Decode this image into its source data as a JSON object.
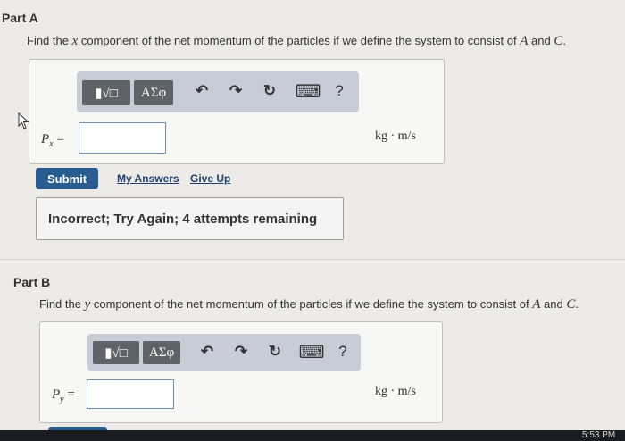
{
  "part_a": {
    "title": "Part A",
    "prompt_pre": "Find the ",
    "prompt_var": "x",
    "prompt_mid": " component of the net momentum of the particles if we define the system to consist of ",
    "prompt_a": "A",
    "prompt_and": " and ",
    "prompt_c": "C",
    "prompt_end": ".",
    "var_label": "P",
    "var_sub": "x",
    "var_eq": "=",
    "input_value": "",
    "units": "kg · m/s",
    "submit_label": "Submit",
    "my_answers_label": "My Answers",
    "give_up_label": "Give Up",
    "feedback": "Incorrect; Try Again; 4 attempts remaining"
  },
  "part_b": {
    "title": "Part B",
    "prompt_pre": "Find the ",
    "prompt_var": "y",
    "prompt_mid": " component of the net momentum of the particles if we define the system to consist of ",
    "prompt_a": "A",
    "prompt_and": " and ",
    "prompt_c": "C",
    "prompt_end": ".",
    "var_label": "P",
    "var_sub": "y",
    "var_eq": "=",
    "input_value": "",
    "units": "kg · m/s"
  },
  "toolbar": {
    "math_template_label": "▮√□",
    "symbols_label": "ΑΣφ",
    "undo_icon": "↶",
    "redo_icon": "↷",
    "reset_icon": "↻",
    "keyboard_icon": "⌨",
    "help_label": "?"
  },
  "taskbar": {
    "clock": "5:53 PM"
  }
}
